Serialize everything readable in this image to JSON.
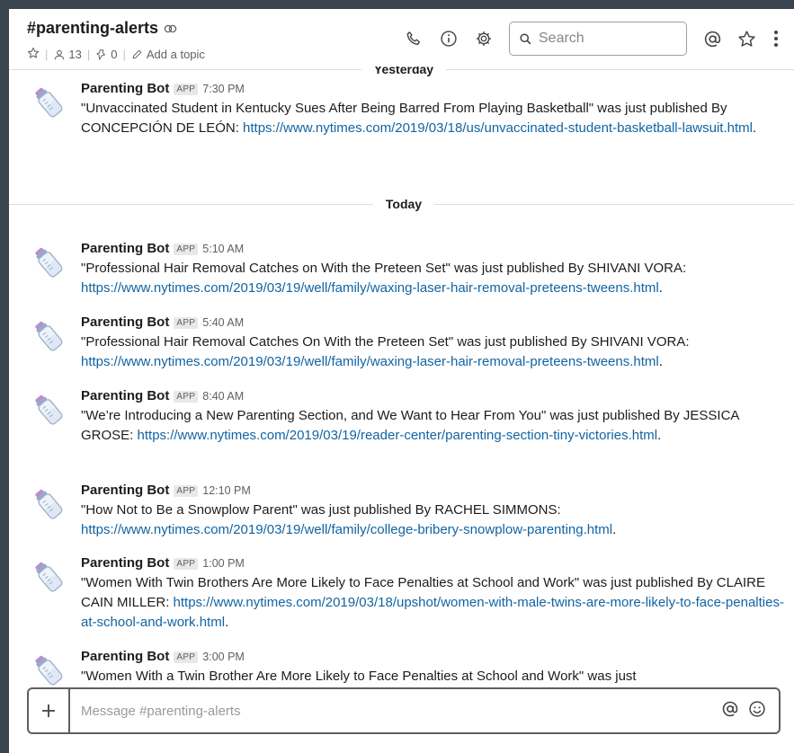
{
  "header": {
    "channel_name": "#parenting-alerts",
    "member_count": "13",
    "pinned_count": "0",
    "add_topic": "Add a topic",
    "search_placeholder": "Search"
  },
  "days": {
    "yesterday": "Yesterday",
    "today": "Today"
  },
  "messages": [
    {
      "author": "Parenting Bot",
      "badge": "APP",
      "time": "7:30 PM",
      "text": "\"Unvaccinated Student in Kentucky Sues After Being Barred From Playing Basketball\" was just published By CONCEPCIÓN DE LEÓN: ",
      "link": "https://www.nytimes.com/2019/03/18/us/unvaccinated-student-basketball-lawsuit.html",
      "tail": "."
    },
    {
      "author": "Parenting Bot",
      "badge": "APP",
      "time": "5:10 AM",
      "text": "\"Professional Hair Removal Catches on With the Preteen Set\" was just published By SHIVANI VORA: ",
      "link": "https://www.nytimes.com/2019/03/19/well/family/waxing-laser-hair-removal-preteens-tweens.html",
      "tail": "."
    },
    {
      "author": "Parenting Bot",
      "badge": "APP",
      "time": "5:40 AM",
      "text": "\"Professional Hair Removal Catches On With the Preteen Set\" was just published By SHIVANI VORA: ",
      "link": "https://www.nytimes.com/2019/03/19/well/family/waxing-laser-hair-removal-preteens-tweens.html",
      "tail": "."
    },
    {
      "author": "Parenting Bot",
      "badge": "APP",
      "time": "8:40 AM",
      "text": "\"We’re Introducing a New Parenting Section, and We Want to Hear From You\" was just published By JESSICA GROSE: ",
      "link": "https://www.nytimes.com/2019/03/19/reader-center/parenting-section-tiny-victories.html",
      "tail": "."
    },
    {
      "author": "Parenting Bot",
      "badge": "APP",
      "time": "12:10 PM",
      "text": "\"How Not to Be a Snowplow Parent\" was just published By RACHEL SIMMONS: ",
      "link": "https://www.nytimes.com/2019/03/19/well/family/college-bribery-snowplow-parenting.html",
      "tail": "."
    },
    {
      "author": "Parenting Bot",
      "badge": "APP",
      "time": "1:00 PM",
      "text": "\"Women With Twin Brothers Are More Likely to Face Penalties at School and Work\" was just published By CLAIRE CAIN MILLER: ",
      "link": "https://www.nytimes.com/2019/03/18/upshot/women-with-male-twins-are-more-likely-to-face-penalties-at-school-and-work.html",
      "tail": "."
    },
    {
      "author": "Parenting Bot",
      "badge": "APP",
      "time": "3:00 PM",
      "text": "\"Women With a Twin Brother Are More Likely to Face Penalties at School and Work\" was just",
      "link": "",
      "tail": ""
    }
  ],
  "composer": {
    "placeholder": "Message #parenting-alerts"
  }
}
